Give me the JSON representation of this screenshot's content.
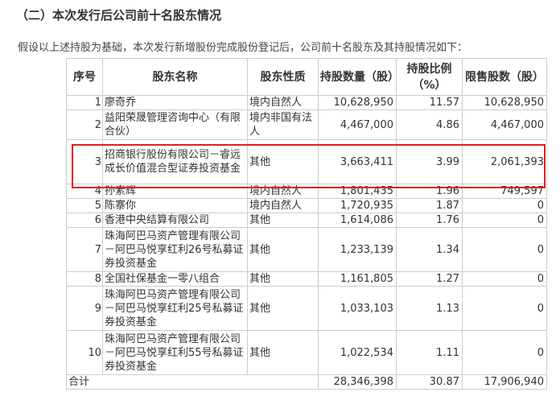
{
  "section": {
    "heading": "（二）本次发行后公司前十名股东情况",
    "intro": "假设以上述持股为基础，本次发行新增股份完成股份登记后，公司前十名股东及其持股情况如下："
  },
  "table": {
    "headers": [
      "序号",
      "股东名称",
      "股东性质",
      "持股数量（股）",
      "持股比例（%）",
      "限售股数（股）"
    ],
    "rows": [
      {
        "seq": "1",
        "name": "廖奇乔",
        "nature": "境内自然人",
        "shares": "10,628,950",
        "ratio": "11.57",
        "restricted": "10,628,950"
      },
      {
        "seq": "2",
        "name": "益阳荣晟管理咨询中心（有限合伙）",
        "nature": "境内非国有法人",
        "shares": "4,467,000",
        "ratio": "4.86",
        "restricted": "4,467,000"
      },
      {
        "seq": "3",
        "name": "招商银行股份有限公司－睿远成长价值混合型证券投资基金",
        "nature": "其他",
        "shares": "3,663,411",
        "ratio": "3.99",
        "restricted": "2,061,393"
      },
      {
        "seq": "4",
        "name": "孙素辉",
        "nature": "境内自然人",
        "shares": "1,801,435",
        "ratio": "1.96",
        "restricted": "749,597"
      },
      {
        "seq": "5",
        "name": "陈寨你",
        "nature": "境内自然人",
        "shares": "1,720,935",
        "ratio": "1.87",
        "restricted": "0"
      },
      {
        "seq": "6",
        "name": "香港中央结算有限公司",
        "nature": "其他",
        "shares": "1,614,086",
        "ratio": "1.76",
        "restricted": "0"
      },
      {
        "seq": "7",
        "name": "珠海阿巴马资产管理有限公司－阿巴马悦享红利26号私募证券投资基金",
        "nature": "其他",
        "shares": "1,233,139",
        "ratio": "1.34",
        "restricted": "0"
      },
      {
        "seq": "8",
        "name": "全国社保基金一零八组合",
        "nature": "其他",
        "shares": "1,161,805",
        "ratio": "1.27",
        "restricted": "0"
      },
      {
        "seq": "9",
        "name": "珠海阿巴马资产管理有限公司－阿巴马悦享红利25号私募证券投资基金",
        "nature": "其他",
        "shares": "1,033,103",
        "ratio": "1.13",
        "restricted": "0"
      },
      {
        "seq": "10",
        "name": "珠海阿巴马资产管理有限公司－阿巴马悦享红利55号私募证券投资基金",
        "nature": "其他",
        "shares": "1,022,534",
        "ratio": "1.11",
        "restricted": "0"
      }
    ],
    "total": {
      "label": "合计",
      "shares": "28,346,398",
      "ratio": "30.87",
      "restricted": "17,906,940"
    }
  },
  "colors": {
    "highlight_border": "#e0201d",
    "grid": "#cccccc"
  }
}
